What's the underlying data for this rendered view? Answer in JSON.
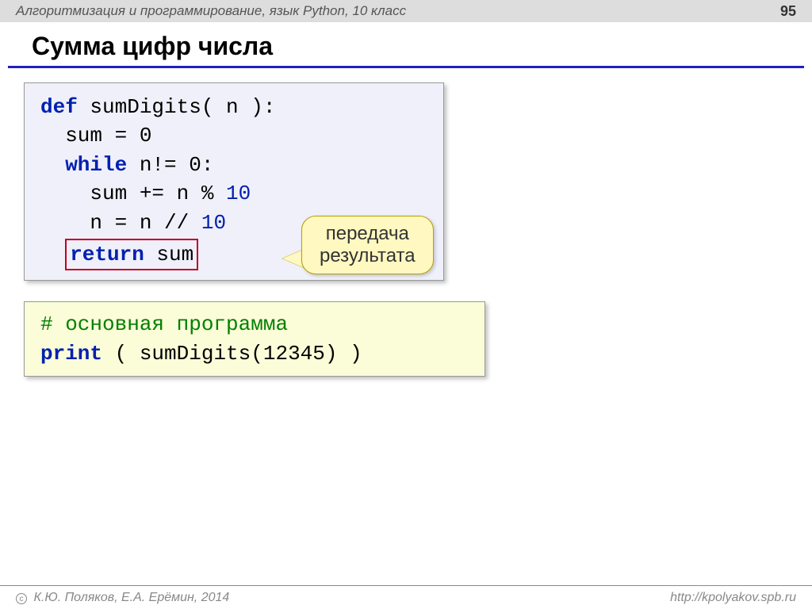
{
  "header": {
    "subject": "Алгоритмизация и программирование, язык Python, 10 класс",
    "page_number": "95"
  },
  "title": "Сумма цифр числа",
  "code1": {
    "l1_def": "def",
    "l1_rest": " sumDigits( n ):",
    "l2": "sum = 0",
    "l3_while": "while",
    "l3_rest": " n!= 0:",
    "l4_a": "sum += n % ",
    "l4_b": "10",
    "l5_a": "n = n // ",
    "l5_b": "10",
    "l6_return": "return",
    "l6_rest": " sum"
  },
  "callout": {
    "line1": "передача",
    "line2": "результата"
  },
  "code2": {
    "comment": "# основная программа",
    "l2_print": "print",
    "l2_a": " ( sumDigits(",
    "l2_num": "12345",
    "l2_b": ") )"
  },
  "footer": {
    "copyright": "К.Ю. Поляков, Е.А. Ерёмин, 2014",
    "url": "http://kpolyakov.spb.ru"
  }
}
